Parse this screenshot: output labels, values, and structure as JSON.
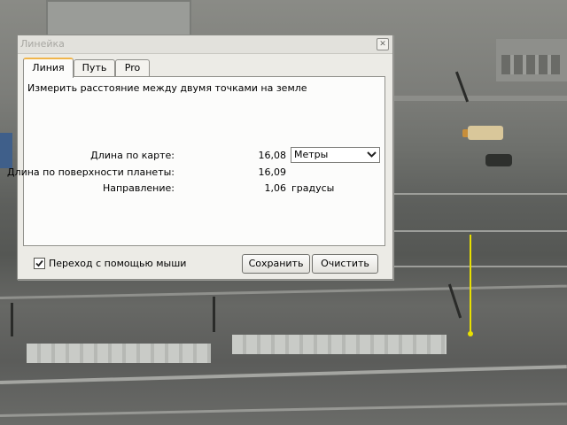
{
  "dialog": {
    "title": "Линейка",
    "close_icon": "close-icon",
    "tabs": [
      {
        "label": "Линия",
        "active": true
      },
      {
        "label": "Путь",
        "active": false
      },
      {
        "label": "Pro",
        "active": false
      }
    ],
    "description": "Измерить расстояние между двумя точками на земле",
    "map_length": {
      "label": "Длина по карте:",
      "value": "16,08"
    },
    "unit_select": {
      "value": "Метры",
      "arrow_icon": "chevron-down-icon"
    },
    "surface_length": {
      "label": "Длина по поверхности планеты:",
      "value": "16,09"
    },
    "heading": {
      "label": "Направление:",
      "value": "1,06",
      "unit": "градусы"
    },
    "mouse_navigation": {
      "label": "Переход с помощью мыши",
      "checked": true
    },
    "save_label": "Сохранить",
    "clear_label": "Очистить"
  },
  "colors": {
    "measure_line": "#e8e000",
    "active_tab_accent": "#f0b54b"
  }
}
